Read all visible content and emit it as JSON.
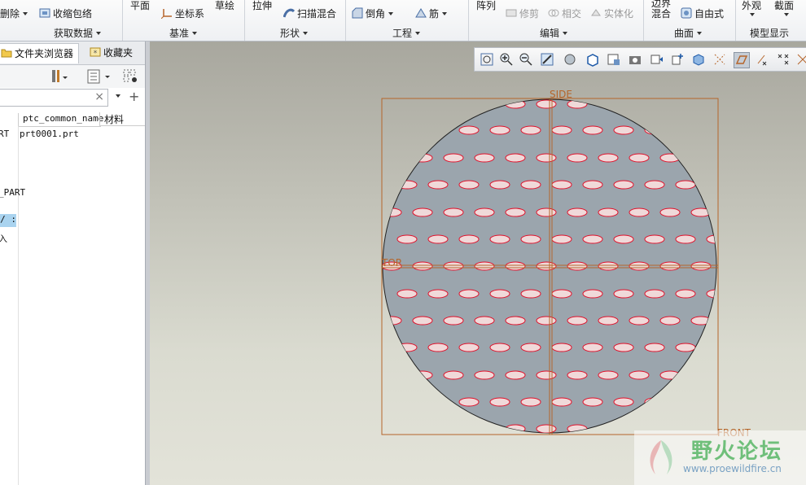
{
  "ribbon": {
    "groups": [
      {
        "id": "fetch",
        "label": "获取数据",
        "items": [
          "删除",
          "收缩包络"
        ]
      },
      {
        "id": "datum",
        "label": "基准",
        "items": [
          "平面",
          "坐标系",
          "草绘"
        ]
      },
      {
        "id": "shape",
        "label": "形状",
        "items": [
          "拉伸",
          "扫描混合"
        ]
      },
      {
        "id": "eng",
        "label": "工程",
        "items": [
          "倒角",
          "筋"
        ]
      },
      {
        "id": "edit",
        "label": "编辑",
        "items": [
          "阵列",
          "修剪",
          "相交",
          "实体化"
        ]
      },
      {
        "id": "surface",
        "label": "曲面",
        "items": [
          "边界混合",
          "自由式"
        ]
      },
      {
        "id": "display",
        "label": "模型显示",
        "items": [
          "外观",
          "截面"
        ]
      }
    ]
  },
  "left_panel": {
    "tabs": [
      "文件夹浏览器",
      "收藏夹"
    ],
    "columns": [
      "ptc_common_name",
      "材料"
    ],
    "rows": [
      {
        "c0": "RT",
        "c1": "prt0001.prt"
      },
      {
        "c0": "_PART",
        "c1": ""
      },
      {
        "c0": "/ :",
        "c1": ""
      },
      {
        "c0": "入",
        "c1": ""
      }
    ],
    "search_clear": "×",
    "add": "+"
  },
  "viewport": {
    "datum_labels": {
      "side": "SIDE",
      "top": "TOP",
      "front": "FRONT"
    },
    "colors": {
      "part_fill": "#9ba5ad",
      "hole": "#f0d9d9",
      "hole_stroke": "#e0102a",
      "datum": "#b5652a"
    }
  },
  "watermark": {
    "title": "野火论坛",
    "url": "www.proewildfire.cn"
  }
}
